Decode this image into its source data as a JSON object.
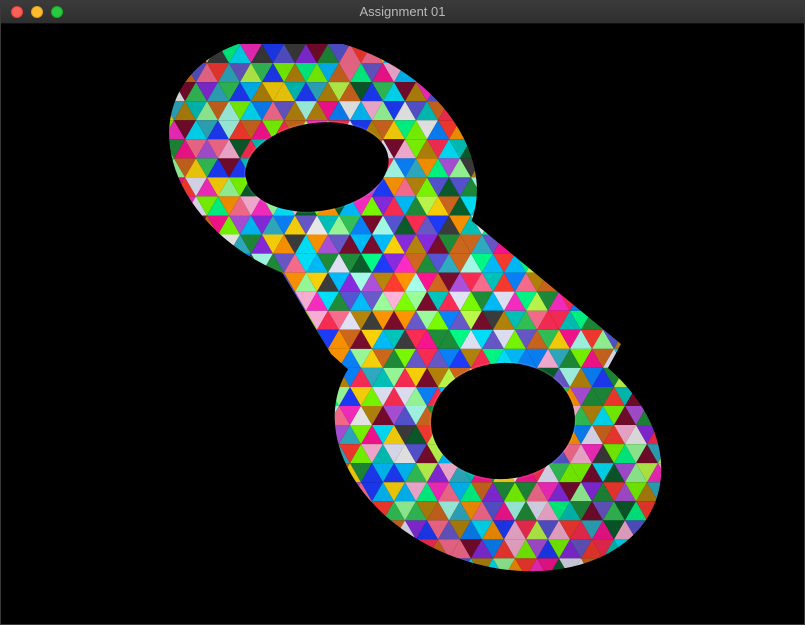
{
  "window": {
    "title": "Assignment 01",
    "close_button": "close",
    "minimize_button": "minimize",
    "zoom_button": "zoom"
  },
  "viewport": {
    "background_color": "#000000",
    "mesh": "double-torus",
    "palette": [
      "#ff2d55",
      "#ff3b30",
      "#ff9500",
      "#ffd60a",
      "#34c759",
      "#00c7be",
      "#30b0c7",
      "#0a84ff",
      "#5856d6",
      "#af52de",
      "#ff2dc5",
      "#7cff00",
      "#00ff88",
      "#00e5ff",
      "#1e3cff",
      "#8a2be2",
      "#ff6f91",
      "#c0ff4d",
      "#1f8f3a",
      "#0b5e2c",
      "#7a0c2e",
      "#3d3d3d",
      "#f2f2f2",
      "#a7ffeb",
      "#ffb3d9",
      "#9bff9b",
      "#6a5acd",
      "#d2691e",
      "#b8860b",
      "#e6e6fa",
      "#ff1493",
      "#00bfff"
    ]
  }
}
